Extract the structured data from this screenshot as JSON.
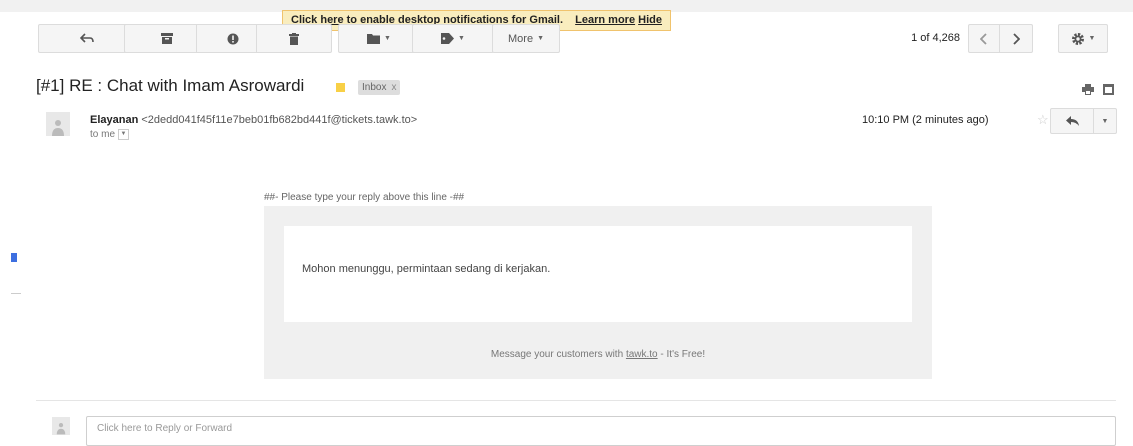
{
  "notification": {
    "enable_link": "Click here to enable",
    "message": "desktop notifications for Gmail.",
    "learn_more": "Learn more",
    "hide": "Hide"
  },
  "toolbar": {
    "more_label": "More",
    "pager_text": "1 of 4,268"
  },
  "email": {
    "subject": "[#1] RE : Chat with Imam Asrowardi",
    "label_chip": "Inbox",
    "label_close": "x",
    "sender_name": "Elayanan",
    "sender_address": "<2dedd041f45f11e7beb01fb682bd441f@tickets.tawk.to>",
    "recipient_text": "to me",
    "time": "10:10 PM (2 minutes ago)"
  },
  "body": {
    "reply_line": "##- Please type your reply above this line -##",
    "message": "Mohon menunggu, permintaan sedang di kerjakan.",
    "footer_prefix": "Message your customers with",
    "footer_link": "tawk.to",
    "footer_suffix": "- It's Free!"
  },
  "reply": {
    "placeholder": "Click here to Reply or Forward"
  },
  "colors": {
    "notification_bg": "#f9edbe",
    "tag_yellow": "#f8d046",
    "button_bg": "#f5f5f5"
  }
}
